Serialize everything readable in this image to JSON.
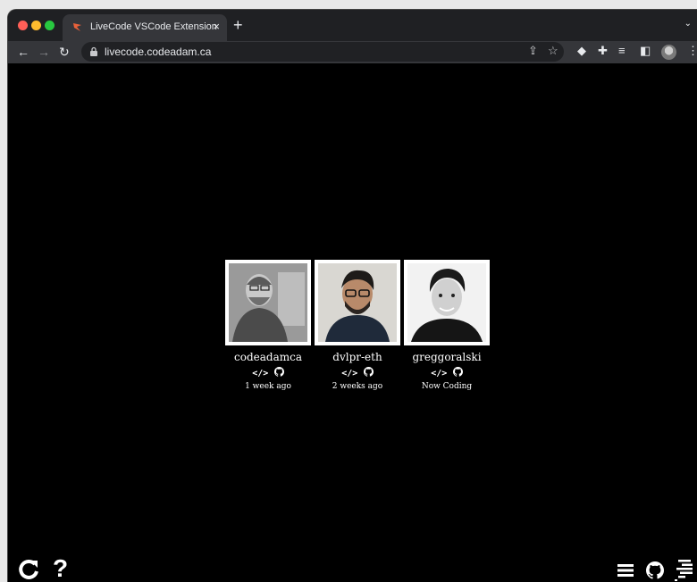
{
  "browser": {
    "tab_title": "LiveCode VSCode Extension",
    "tab_close_glyph": "×",
    "new_tab_glyph": "+",
    "url": "livecode.codeadam.ca"
  },
  "users": [
    {
      "name": "codeadamca",
      "status": "1 week ago"
    },
    {
      "name": "dvlpr-eth",
      "status": "2 weeks ago"
    },
    {
      "name": "greggoralski",
      "status": "Now Coding"
    }
  ],
  "icons": {
    "code": "code-icon",
    "github": "github-icon",
    "refresh": "refresh-icon",
    "help": "question-icon",
    "menu": "hamburger-menu-icon",
    "logo": "livecode-logo-icon"
  },
  "colors": {
    "background": "#000000",
    "text": "#ffffff",
    "photo_border": "#ffffff"
  }
}
